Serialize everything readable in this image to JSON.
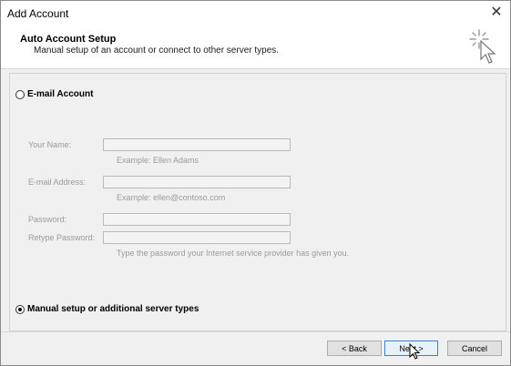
{
  "window": {
    "title": "Add Account",
    "close_glyph": "✕"
  },
  "header": {
    "title": "Auto Account Setup",
    "subtitle": "Manual setup of an account or connect to other server types."
  },
  "options": {
    "email_account": {
      "label": "E-mail Account",
      "selected": false
    },
    "manual_setup": {
      "label": "Manual setup or additional server types",
      "selected": true
    }
  },
  "fields": {
    "your_name": {
      "label": "Your Name:",
      "value": "",
      "hint": "Example: Ellen Adams"
    },
    "email_address": {
      "label": "E-mail Address:",
      "value": "",
      "hint": "Example: ellen@contoso.com"
    },
    "password": {
      "label": "Password:",
      "value": ""
    },
    "retype_password": {
      "label": "Retype Password:",
      "value": "",
      "hint": "Type the password your Internet service provider has given you."
    }
  },
  "buttons": {
    "back": "< Back",
    "next": "Next >",
    "cancel": "Cancel"
  },
  "icons": {
    "wizard": "wizard-cursor-icon",
    "close": "close-icon",
    "pointer": "mouse-pointer-icon"
  },
  "colors": {
    "accent": "#3c7fd6",
    "disabled_text": "#9a9a9a"
  }
}
